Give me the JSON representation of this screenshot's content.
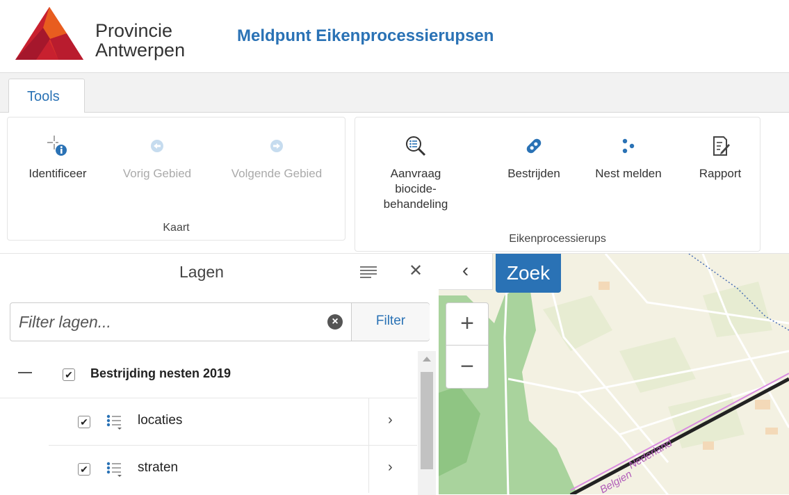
{
  "header": {
    "org_line1": "Provincie",
    "org_line2": "Antwerpen",
    "app_title": "Meldpunt Eikenprocessierupsen"
  },
  "tabs": [
    {
      "label": "Tools",
      "active": true
    }
  ],
  "ribbon": {
    "groups": [
      {
        "label": "Kaart",
        "tools": [
          {
            "label": "Identificeer",
            "icon": "identify-icon",
            "enabled": true
          },
          {
            "label": "Vorig Gebied",
            "icon": "arrow-left-icon",
            "enabled": false
          },
          {
            "label": "Volgende Gebied",
            "icon": "arrow-right-icon",
            "enabled": false
          }
        ]
      },
      {
        "label": "Eikenprocessierups",
        "tools": [
          {
            "label": "Aanvraag biocide-behandeling",
            "label_lines": [
              "Aanvraag",
              "biocide-",
              "behandeling"
            ],
            "icon": "magnifier-list-icon",
            "enabled": true
          },
          {
            "label": "Bestrijden",
            "icon": "bandage-icon",
            "enabled": true
          },
          {
            "label": "Nest melden",
            "icon": "dots-icon",
            "enabled": true
          },
          {
            "label": "Rapport",
            "icon": "report-icon",
            "enabled": true
          }
        ]
      }
    ]
  },
  "layers_panel": {
    "title": "Lagen",
    "filter": {
      "placeholder": "Filter lagen...",
      "value": "",
      "button_label": "Filter"
    },
    "tree": [
      {
        "label": "Bestrijding nesten 2019",
        "checked": true,
        "expanded": true,
        "children": [
          {
            "label": "locaties",
            "checked": true
          },
          {
            "label": "straten",
            "checked": true
          }
        ]
      }
    ]
  },
  "map": {
    "search_button": "Zoek",
    "labels": [
      "Nederland",
      "Belgien"
    ],
    "colors": {
      "forest": "#a9d39d",
      "field": "#f3f1e2",
      "road": "#ffffff",
      "border": "#222222",
      "border_label": "#b05ab8",
      "water": "#4a6fb5"
    }
  },
  "colors": {
    "accent": "#2a72b5",
    "logo_red": "#c8202f",
    "logo_orange": "#e85d1f"
  }
}
